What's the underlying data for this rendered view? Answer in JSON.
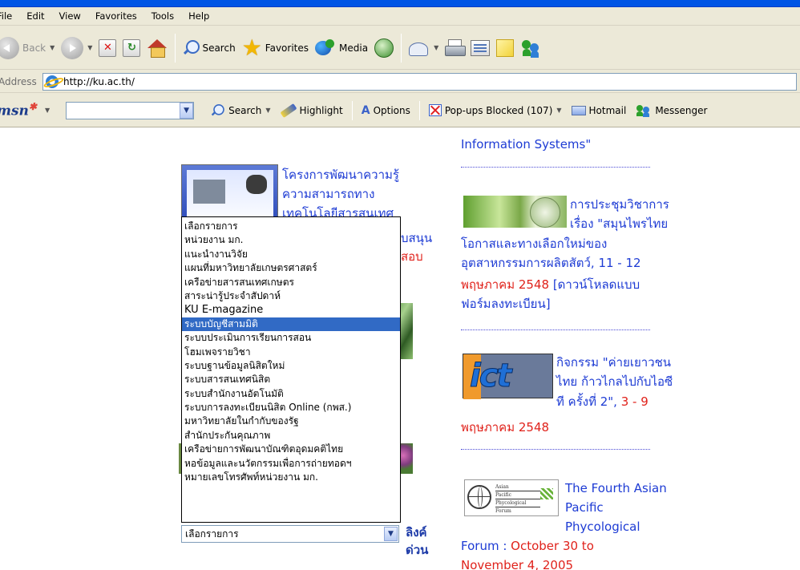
{
  "menubar": {
    "items": [
      "File",
      "Edit",
      "View",
      "Favorites",
      "Tools",
      "Help"
    ]
  },
  "toolbar": {
    "back": "Back",
    "search": "Search",
    "favorites": "Favorites",
    "media": "Media"
  },
  "address": {
    "label": "Address",
    "url": "http://ku.ac.th/"
  },
  "msn": {
    "logo": "msn",
    "search_placeholder": "",
    "search": "Search",
    "highlight": "Highlight",
    "options": "Options",
    "popups": "Pop-ups Blocked (107)",
    "hotmail": "Hotmail",
    "messenger": "Messenger"
  },
  "icons": {
    "back": "back-arrow-icon",
    "forward": "forward-arrow-icon",
    "stop": "stop-icon",
    "refresh": "refresh-icon",
    "home": "home-icon",
    "search": "search-icon",
    "favorites": "star-icon",
    "media": "media-icon",
    "history": "history-icon",
    "mail": "mail-icon",
    "print": "printer-icon",
    "edit": "edit-icon",
    "discuss": "note-icon",
    "messenger": "messenger-icon"
  },
  "content": {
    "top_right": "Information Systems\"",
    "item1": {
      "line1": "โครงการพัฒนาความรู้",
      "line2": "ความสามารถทาง",
      "line3": "เทคโนโลยีสารสนเทศ",
      "frag_a": "บสนุน",
      "frag_b": "สอบ"
    },
    "herb": {
      "l1": "การประชุมวิชาการ",
      "l2": "เรื่อง \"สมุนไพรไทย",
      "l3": "โอกาสและทางเลือกใหม่ของ",
      "l4": "อุตสาหกรรมการผลิตสัตว์, 11 - 12",
      "l5_red": "พฤษภาคม 2548",
      "l5_blue": " [ดาวน์โหลดแบบ",
      "l6": "ฟอร์มลงทะเบียน]"
    },
    "ict": {
      "logo": "ict",
      "l1": "กิจกรรม \"ค่ายเยาวชน",
      "l2": "ไทย ก้าวไกลไปกับไอซี",
      "l3_blue": "ที ครั้งที่ 2\",",
      "l3_red": " 3 - 9",
      "l4": "พฤษภาคม 2548"
    },
    "apf": {
      "logo_lines": [
        "Asian",
        "Pacific",
        "Phycological",
        "Forum"
      ],
      "l1": "The Fourth Asian",
      "l2": "Pacific",
      "l3": "Phycological",
      "l4_blue": "Forum : ",
      "l4_red": "October 30 to",
      "l5": "November 4, 2005"
    }
  },
  "dropdown": {
    "options": [
      "เลือกรายการ",
      "หน่วยงาน มก.",
      "แนะนำงานวิจัย",
      "แผนที่มหาวิทยาลัยเกษตรศาสตร์",
      "เครือข่ายสารสนเทศเกษตร",
      "สาระน่ารู้ประจำสัปดาห์",
      "KU E-magazine",
      "ระบบบัญชีสามมิติ",
      "ระบบประเมินการเรียนการสอน",
      "โฮมเพจรายวิชา",
      "ระบบฐานข้อมูลนิสิตใหม่",
      "ระบบสารสนเทศนิสิต",
      "ระบบสำนักงานอัตโนมัติ",
      "ระบบการลงทะเบียนนิสิต Online (กพส.)",
      "มหาวิทยาลัยในกำกับของรัฐ",
      "สำนักประกันคุณภาพ",
      "เครือข่ายการพัฒนาบัณฑิตอุดมคติไทย",
      "หอข้อมูลและนวัตกรรมเพื่อการถ่ายทอดฯ",
      "หมายเลขโทรศัพท์หน่วยงาน มก."
    ],
    "selected_index": 7,
    "current_value": "เลือกรายการ",
    "side_label_1": "ลิงค์",
    "side_label_2": "ด่วน"
  }
}
